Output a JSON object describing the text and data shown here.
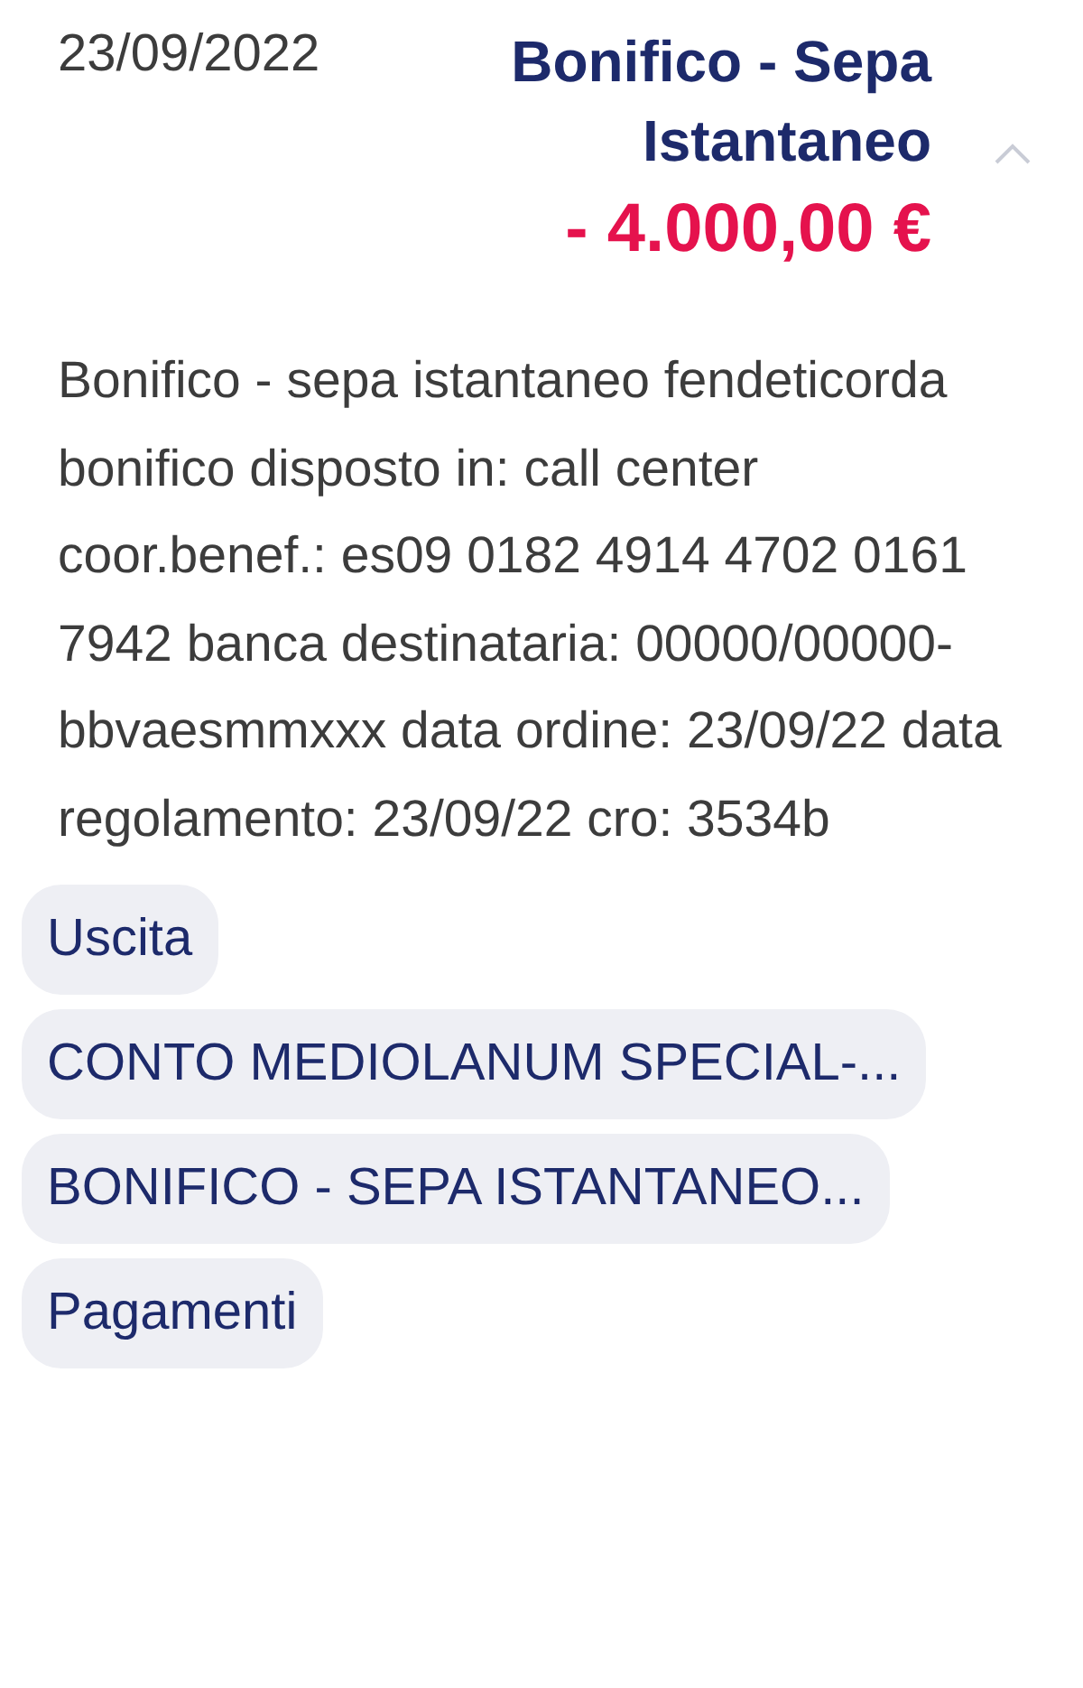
{
  "transaction": {
    "date": "23/09/2022",
    "title": "Bonifico - Sepa Istantaneo",
    "expanded": true,
    "amount": "- 4.000,00 €"
  },
  "description": "Bonifico - sepa istantaneo fendeticorda bonifico disposto in: call center coor.benef.: es09 0182 4914 4702 0161 7942 banca destinataria: 00000/00000-bbvaesmmxxx data ordine: 23/09/22 data regolamento: 23/09/22 cro: 3534b",
  "tags": [
    "Uscita",
    "CONTO MEDIOLANUM SPECIAL-...",
    "BONIFICO - SEPA ISTANTANEO...",
    "Pagamenti"
  ]
}
